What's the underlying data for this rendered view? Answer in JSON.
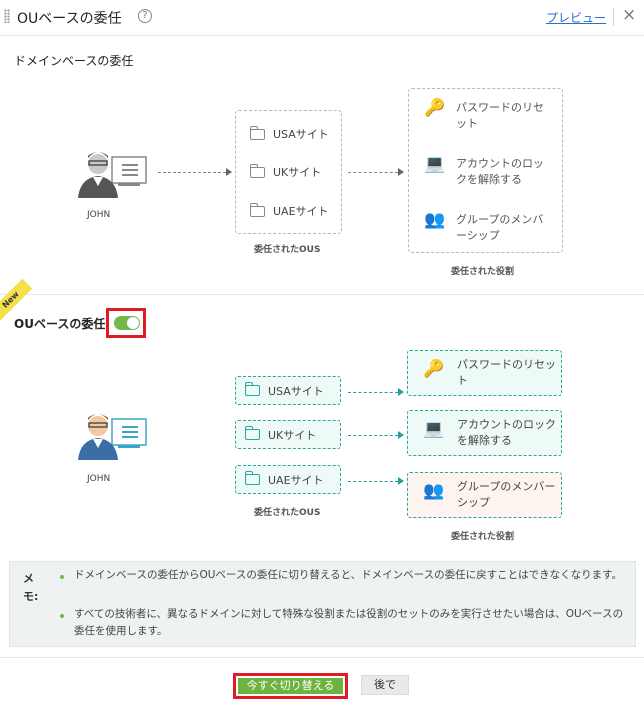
{
  "header": {
    "title": "OUベースの委任",
    "help_icon": "?",
    "preview_link": "プレビュー",
    "close_icon": "×"
  },
  "domain_section": {
    "title": "ドメインベースの委任",
    "user": "JOHN",
    "sites": [
      "USAサイト",
      "UKサイト",
      "UAEサイト"
    ],
    "sites_caption": "委任されたOUS",
    "roles": [
      {
        "icon": "key-user-icon",
        "lines": [
          "パスワードのリセ",
          "ット"
        ]
      },
      {
        "icon": "laptop-lock-icon",
        "lines": [
          "アカウントのロッ",
          "クを解除する"
        ]
      },
      {
        "icon": "group-users-icon",
        "lines": [
          "グループのメンバ",
          "ーシップ"
        ]
      }
    ],
    "roles_caption": "委任された役割"
  },
  "ou_section": {
    "ribbon": "New",
    "title": "OUベースの委任",
    "toggle_on": true,
    "user": "JOHN",
    "sites": [
      "USAサイト",
      "UKサイト",
      "UAEサイト"
    ],
    "sites_caption": "委任されたOUS",
    "roles": [
      {
        "icon": "key-user-icon",
        "lines": [
          "パスワードのリセット",
          ""
        ],
        "bg": "#eefaf7"
      },
      {
        "icon": "laptop-lock-icon",
        "lines": [
          "アカウントのロック",
          "を解除する"
        ],
        "bg": "#eefaf7"
      },
      {
        "icon": "group-users-icon",
        "lines": [
          "グループのメンバー",
          "シップ"
        ],
        "bg": "#fdf3ef"
      }
    ],
    "roles_caption": "委任された役割"
  },
  "note": {
    "label": "メモ:",
    "items": [
      "ドメインベースの委任からOUベースの委任に切り替えると、ドメインベースの委任に戻すことはできなくなります。",
      "すべての技術者に、異なるドメインに対して特殊な役割または役割のセットのみを実行させたい場合は、OUベースの委任を使用します。"
    ]
  },
  "footer": {
    "switch_now": "今すぐ切り替える",
    "later": "後で"
  },
  "colors": {
    "accent_green": "#6cb43f",
    "teal": "#2aa6a0",
    "highlight_red": "#e01b24",
    "link_blue": "#2a6fcd"
  }
}
